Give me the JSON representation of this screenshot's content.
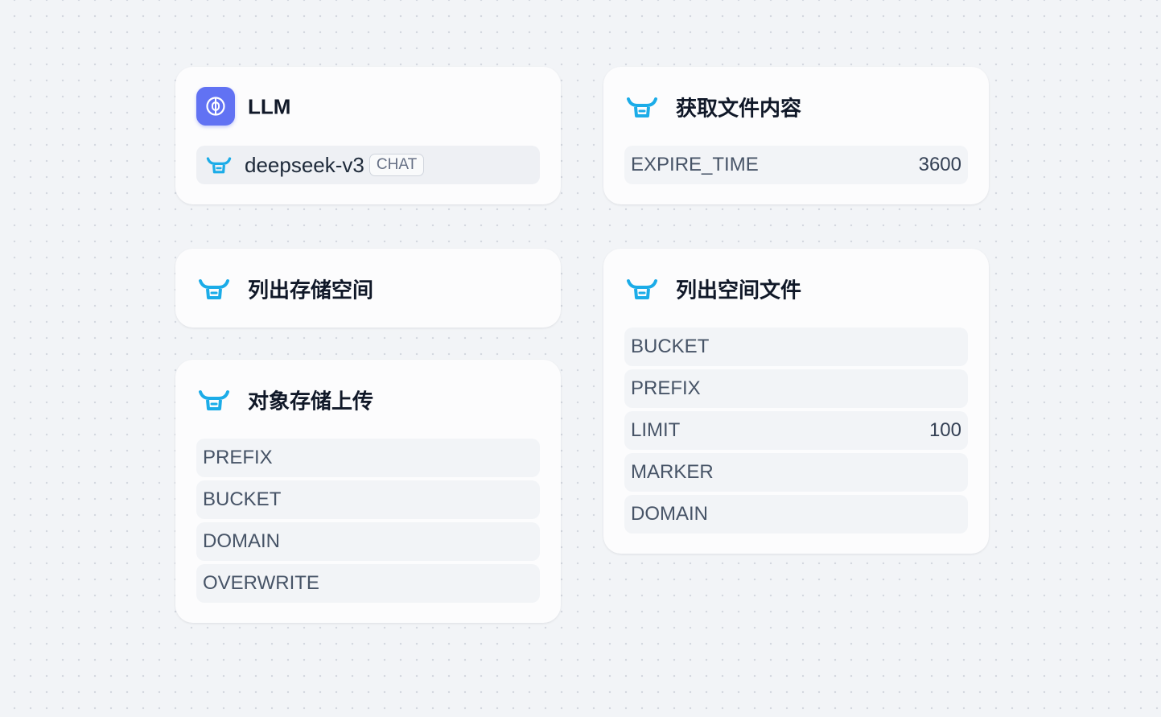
{
  "nodes": {
    "llm": {
      "title": "LLM",
      "model_name": "deepseek-v3",
      "model_type": "CHAT"
    },
    "get_file_content": {
      "title": "获取文件内容",
      "params": [
        {
          "name": "EXPIRE_TIME",
          "value": "3600"
        }
      ]
    },
    "list_buckets": {
      "title": "列出存储空间"
    },
    "list_files": {
      "title": "列出空间文件",
      "params": [
        {
          "name": "BUCKET",
          "value": ""
        },
        {
          "name": "PREFIX",
          "value": ""
        },
        {
          "name": "LIMIT",
          "value": "100"
        },
        {
          "name": "MARKER",
          "value": ""
        },
        {
          "name": "DOMAIN",
          "value": ""
        }
      ]
    },
    "upload": {
      "title": "对象存储上传",
      "params": [
        {
          "name": "PREFIX",
          "value": ""
        },
        {
          "name": "BUCKET",
          "value": ""
        },
        {
          "name": "DOMAIN",
          "value": ""
        },
        {
          "name": "OVERWRITE",
          "value": ""
        }
      ]
    }
  },
  "icons": {
    "llm": "brain-icon",
    "tool": "qiniu-bull-icon"
  },
  "colors": {
    "llm_badge": "#6172f3",
    "tool_icon": "#1bace8",
    "background": "#f2f4f7"
  }
}
